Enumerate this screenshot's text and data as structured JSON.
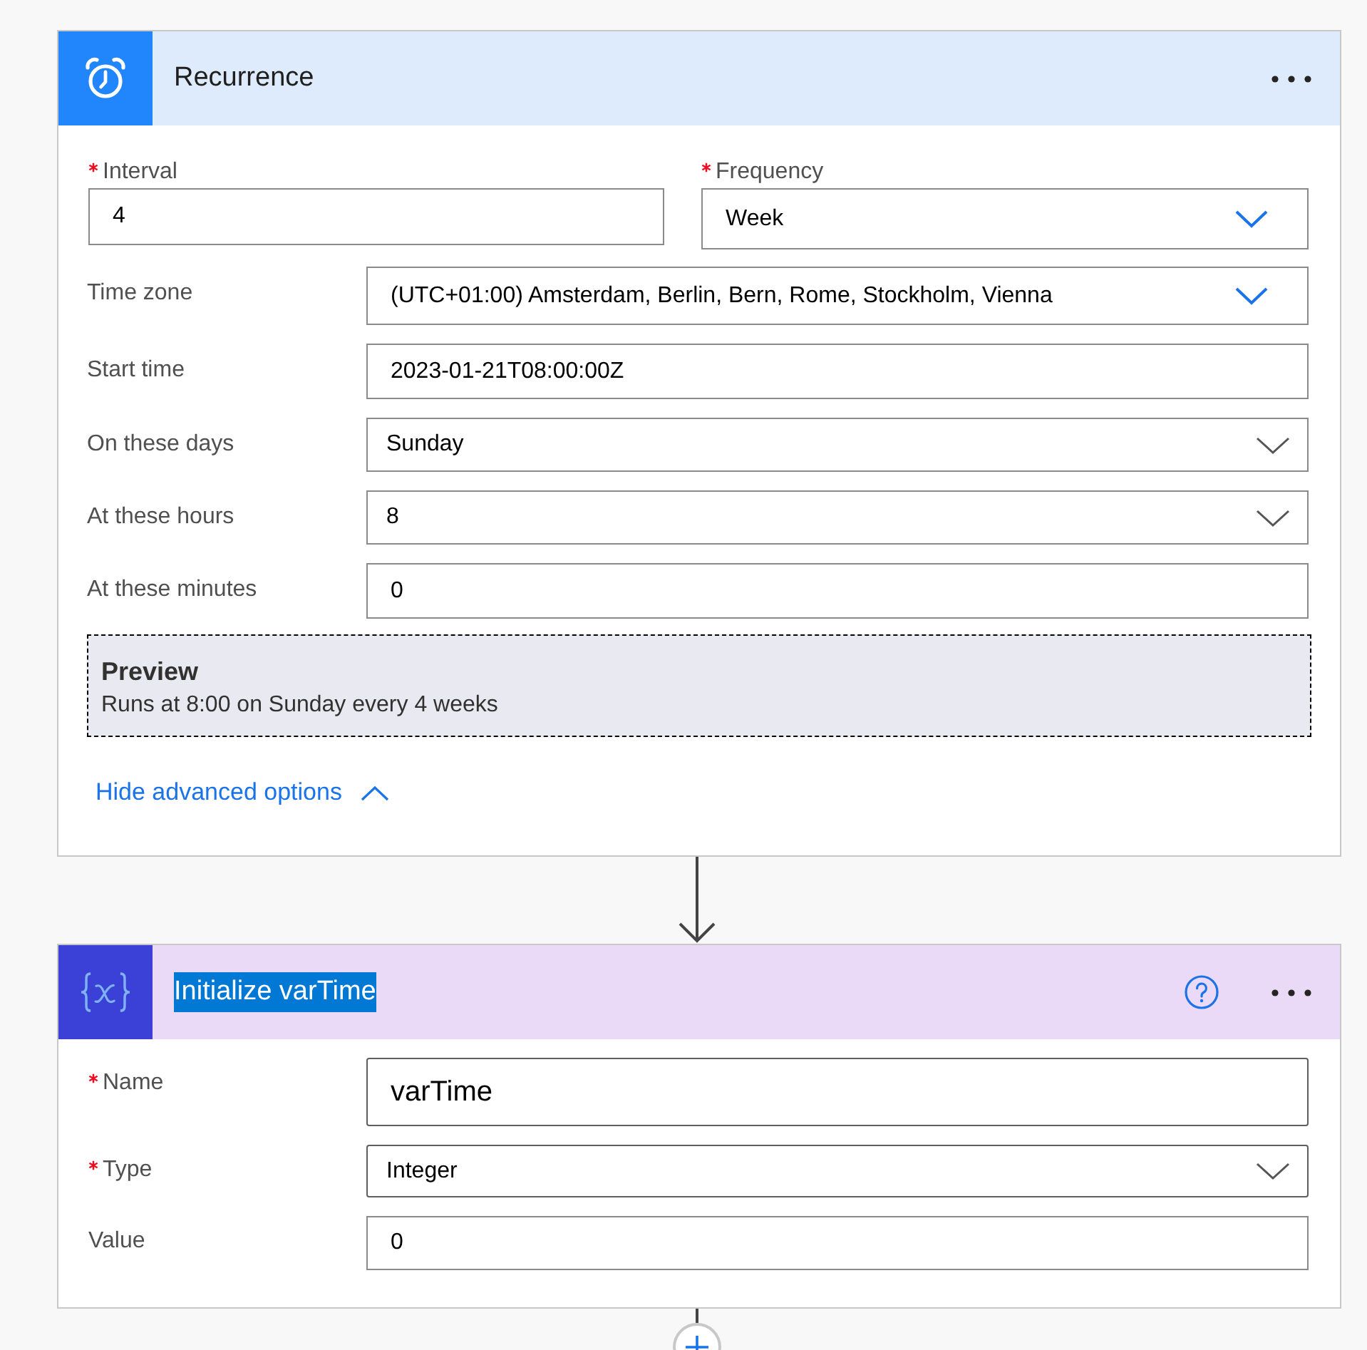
{
  "cards": [
    {
      "kind": "recurrence",
      "title": {
        "text": "Recurrence",
        "selected": false
      },
      "top_fields": [
        {
          "label": "Interval",
          "required": true,
          "kind": "text",
          "value": "4"
        },
        {
          "label": "Frequency",
          "required": true,
          "kind": "dropdown",
          "value": "Week"
        }
      ],
      "fields": [
        {
          "label": "Time zone",
          "required": false,
          "kind": "dropdown",
          "value": "(UTC+01:00) Amsterdam, Berlin, Bern, Rome, Stockholm, Vienna"
        },
        {
          "label": "Start time",
          "required": false,
          "kind": "text",
          "value": "2023-01-21T08:00:00Z"
        },
        {
          "label": "On these days",
          "required": false,
          "kind": "picker",
          "value": "Sunday"
        },
        {
          "label": "At these hours",
          "required": false,
          "kind": "picker",
          "value": "8"
        },
        {
          "label": "At these minutes",
          "required": false,
          "kind": "text",
          "value": "0"
        }
      ],
      "preview": {
        "heading": "Preview",
        "text": "Runs at 8:00 on Sunday every 4 weeks"
      },
      "advanced_options": {
        "label": "Hide advanced options",
        "expanded": true
      }
    },
    {
      "kind": "variable",
      "title": {
        "text": "Initialize varTime",
        "selected": true
      },
      "help_button": true,
      "fields": [
        {
          "label": "Name",
          "required": true,
          "kind": "text",
          "value": "varTime"
        },
        {
          "label": "Type",
          "required": true,
          "kind": "picker",
          "value": "Integer"
        },
        {
          "label": "Value",
          "required": false,
          "kind": "text",
          "value": "0"
        }
      ]
    }
  ]
}
